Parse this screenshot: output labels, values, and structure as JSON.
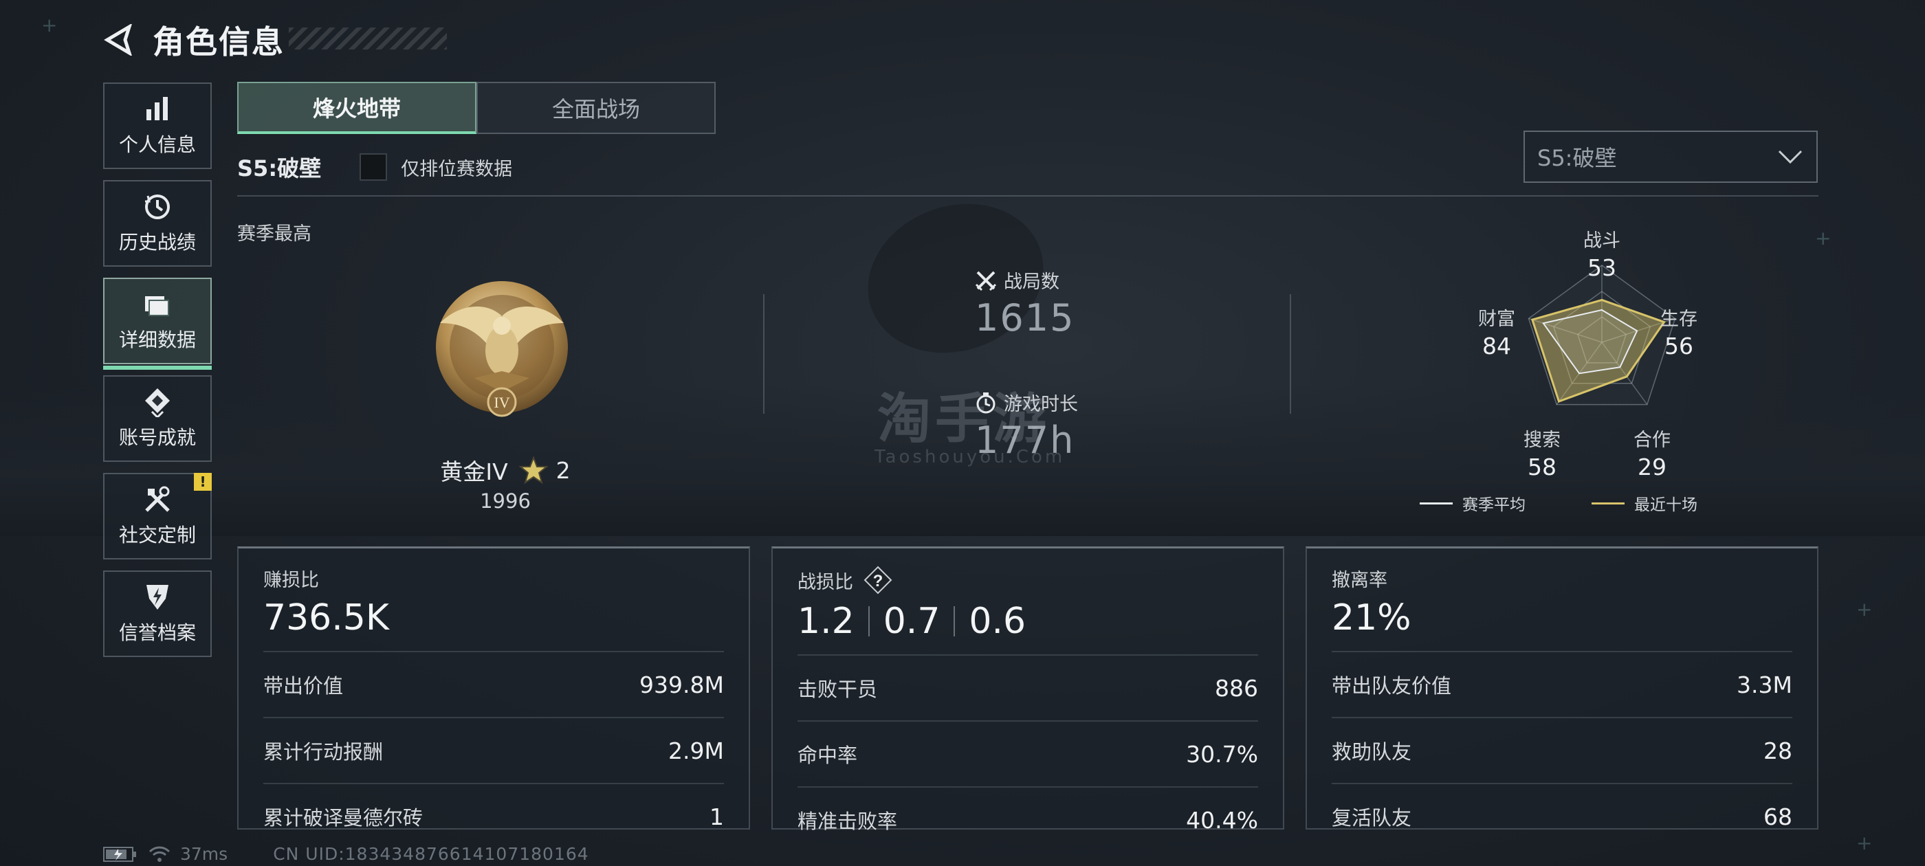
{
  "header": {
    "title": "角色信息"
  },
  "sidebar": {
    "items": [
      {
        "label": "个人信息",
        "icon": "bar-chart-icon"
      },
      {
        "label": "历史战绩",
        "icon": "history-clock-icon"
      },
      {
        "label": "详细数据",
        "icon": "folder-icon",
        "active": true
      },
      {
        "label": "账号成就",
        "icon": "achievement-icon"
      },
      {
        "label": "社交定制",
        "icon": "tools-icon",
        "badge": "!"
      },
      {
        "label": "信誉档案",
        "icon": "shield-icon"
      }
    ]
  },
  "tabs": [
    {
      "label": "烽火地带",
      "active": true
    },
    {
      "label": "全面战场",
      "active": false
    }
  ],
  "season": {
    "name": "S5:破壁",
    "ranked_only_label": "仅排位赛数据",
    "select_value": "S5:破壁",
    "best_label": "赛季最高"
  },
  "rank": {
    "name": "黄金IV",
    "stars": "2",
    "score": "1996",
    "tier_numeral": "IV"
  },
  "stats": {
    "matches_label": "战局数",
    "matches_value": "1615",
    "playtime_label": "游戏时长",
    "playtime_value": "177h"
  },
  "watermark": {
    "main": "淘手游",
    "sub": "Taoshouyou.Com"
  },
  "radar": {
    "axes": [
      {
        "label": "战斗",
        "value": "53"
      },
      {
        "label": "生存",
        "value": "56"
      },
      {
        "label": "合作",
        "value": "29"
      },
      {
        "label": "搜索",
        "value": "58"
      },
      {
        "label": "财富",
        "value": "84"
      }
    ],
    "season_avg": [
      0.42,
      0.48,
      0.4,
      0.5,
      0.8
    ],
    "recent_ten": [
      0.55,
      0.85,
      0.55,
      0.95,
      0.95
    ],
    "legend": {
      "season_avg": "赛季平均",
      "recent_ten": "最近十场"
    },
    "colors": {
      "season_avg": "#e8ecef",
      "recent_ten": "#d8c46a"
    }
  },
  "panels": [
    {
      "title": "赚损比",
      "main": "736.5K",
      "rows": [
        {
          "label": "带出价值",
          "value": "939.8M"
        },
        {
          "label": "累计行动报酬",
          "value": "2.9M"
        },
        {
          "label": "累计破译曼德尔砖",
          "value": "1"
        }
      ]
    },
    {
      "title": "战损比",
      "kd": [
        "1.2",
        "0.7",
        "0.6"
      ],
      "help": "?",
      "rows": [
        {
          "label": "击败干员",
          "value": "886"
        },
        {
          "label": "命中率",
          "value": "30.7%"
        },
        {
          "label": "精准击败率",
          "value": "40.4%"
        }
      ]
    },
    {
      "title": "撤离率",
      "main": "21%",
      "rows": [
        {
          "label": "带出队友价值",
          "value": "3.3M"
        },
        {
          "label": "救助队友",
          "value": "28"
        },
        {
          "label": "复活队友",
          "value": "68"
        }
      ]
    }
  ],
  "status": {
    "ping": "37ms",
    "uid": "CN UID:1834348766141071801​64"
  },
  "colors": {
    "accent": "#7fd9b0",
    "warn": "#e8c93c",
    "gold": "#d8c46a"
  }
}
